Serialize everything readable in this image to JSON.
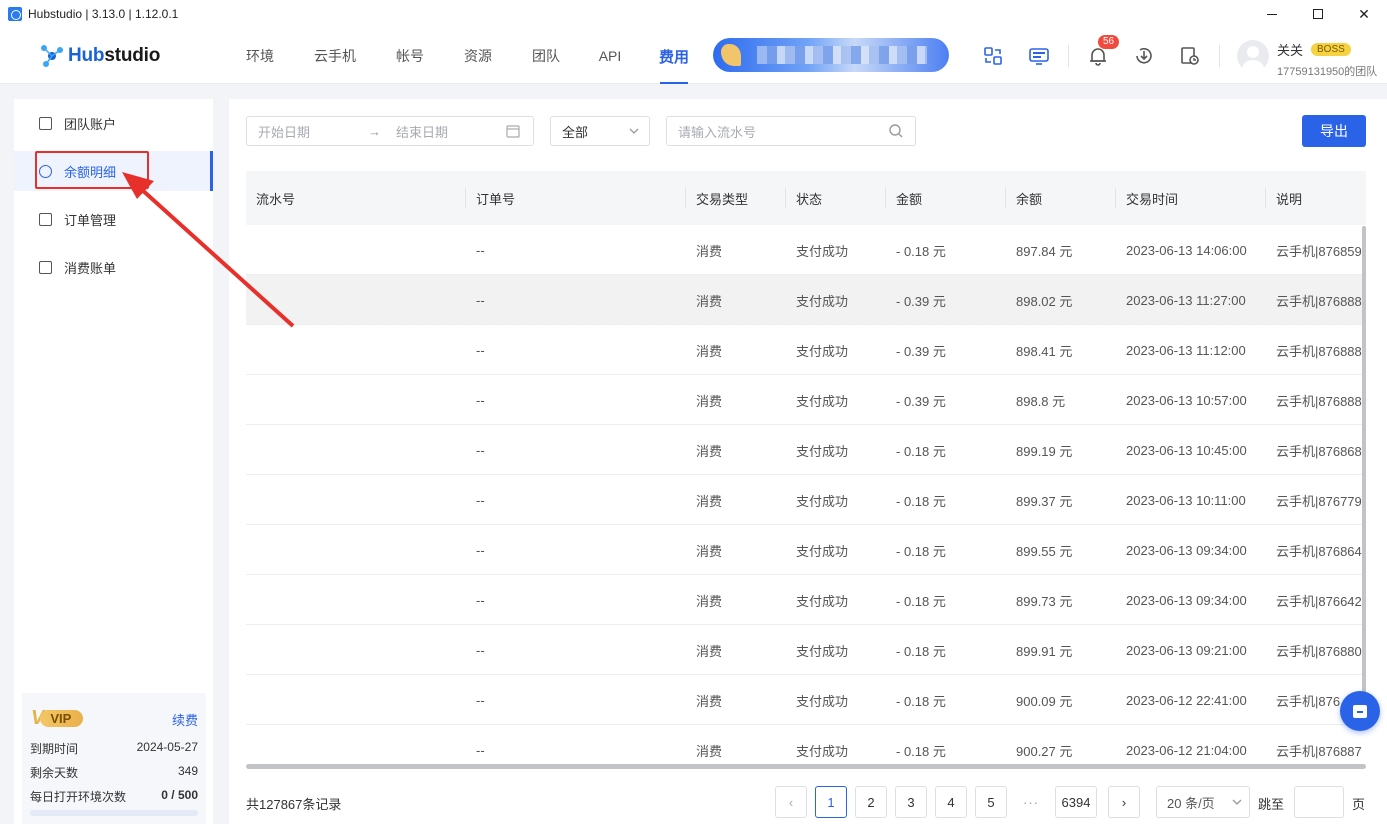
{
  "window": {
    "title": "Hubstudio | 3.13.0 | 1.12.0.1"
  },
  "logo": {
    "text_hub": "Hub",
    "text_rest": "studio"
  },
  "nav": {
    "items": [
      {
        "label": "环境",
        "width": 64
      },
      {
        "label": "云手机",
        "width": 86
      },
      {
        "label": "帐号",
        "width": 64
      },
      {
        "label": "资源",
        "width": 72
      },
      {
        "label": "团队",
        "width": 64
      },
      {
        "label": "API",
        "width": 64
      },
      {
        "label": "费用",
        "width": 64
      }
    ],
    "active": "费用"
  },
  "notifications": {
    "count": "56"
  },
  "user": {
    "name": "关关",
    "role": "BOSS",
    "team": "17759131950的团队"
  },
  "sidebar": {
    "items": [
      {
        "label": "团队账户"
      },
      {
        "label": "余额明细"
      },
      {
        "label": "订单管理"
      },
      {
        "label": "消费账单"
      }
    ],
    "active_index": 1
  },
  "vip": {
    "badge": "VIP",
    "renew": "续费",
    "expiry_label": "到期时间",
    "expiry_value": "2024-05-27",
    "days_label": "剩余天数",
    "days_value": "349",
    "opens_label": "每日打开环境次数",
    "opens_value": "0 / 500"
  },
  "filters": {
    "start_placeholder": "开始日期",
    "end_placeholder": "结束日期",
    "type_value": "全部",
    "search_placeholder": "请输入流水号"
  },
  "export_label": "导出",
  "table": {
    "columns": [
      "流水号",
      "订单号",
      "交易类型",
      "状态",
      "金额",
      "余额",
      "交易时间",
      "说明"
    ],
    "rows": [
      {
        "serial": "",
        "order": "--",
        "type": "消费",
        "status": "支付成功",
        "amount": "- 0.18 元",
        "balance": "897.84 元",
        "time": "2023-06-13 14:06:00",
        "desc": "云手机|876859"
      },
      {
        "serial": "",
        "order": "--",
        "type": "消费",
        "status": "支付成功",
        "amount": "- 0.39 元",
        "balance": "898.02 元",
        "time": "2023-06-13 11:27:00",
        "desc": "云手机|876888"
      },
      {
        "serial": "",
        "order": "--",
        "type": "消费",
        "status": "支付成功",
        "amount": "- 0.39 元",
        "balance": "898.41 元",
        "time": "2023-06-13 11:12:00",
        "desc": "云手机|876888"
      },
      {
        "serial": "",
        "order": "--",
        "type": "消费",
        "status": "支付成功",
        "amount": "- 0.39 元",
        "balance": "898.8 元",
        "time": "2023-06-13 10:57:00",
        "desc": "云手机|876888"
      },
      {
        "serial": "",
        "order": "--",
        "type": "消费",
        "status": "支付成功",
        "amount": "- 0.18 元",
        "balance": "899.19 元",
        "time": "2023-06-13 10:45:00",
        "desc": "云手机|876868"
      },
      {
        "serial": "",
        "order": "--",
        "type": "消费",
        "status": "支付成功",
        "amount": "- 0.18 元",
        "balance": "899.37 元",
        "time": "2023-06-13 10:11:00",
        "desc": "云手机|876779"
      },
      {
        "serial": "",
        "order": "--",
        "type": "消费",
        "status": "支付成功",
        "amount": "- 0.18 元",
        "balance": "899.55 元",
        "time": "2023-06-13 09:34:00",
        "desc": "云手机|876864"
      },
      {
        "serial": "",
        "order": "--",
        "type": "消费",
        "status": "支付成功",
        "amount": "- 0.18 元",
        "balance": "899.73 元",
        "time": "2023-06-13 09:34:00",
        "desc": "云手机|876642"
      },
      {
        "serial": "",
        "order": "--",
        "type": "消费",
        "status": "支付成功",
        "amount": "- 0.18 元",
        "balance": "899.91 元",
        "time": "2023-06-13 09:21:00",
        "desc": "云手机|876880"
      },
      {
        "serial": "",
        "order": "--",
        "type": "消费",
        "status": "支付成功",
        "amount": "- 0.18 元",
        "balance": "900.09 元",
        "time": "2023-06-12 22:41:00",
        "desc": "云手机|876"
      },
      {
        "serial": "",
        "order": "--",
        "type": "消费",
        "status": "支付成功",
        "amount": "- 0.18 元",
        "balance": "900.27 元",
        "time": "2023-06-12 21:04:00",
        "desc": "云手机|876887"
      }
    ]
  },
  "pagination": {
    "total": "共127867条记录",
    "pages": [
      "1",
      "2",
      "3",
      "4",
      "5"
    ],
    "ellipsis": "···",
    "last": "6394",
    "active": "1",
    "page_size": "20 条/页",
    "jump_label": "跳至",
    "page_suffix": "页"
  }
}
